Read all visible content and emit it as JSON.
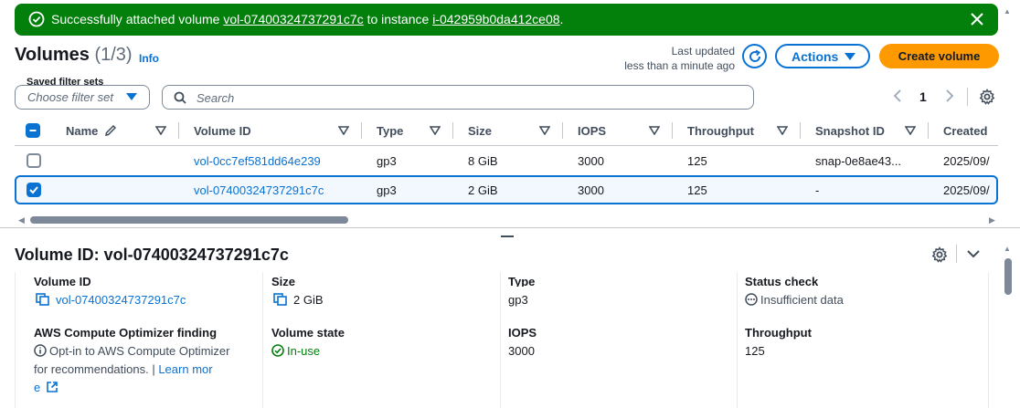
{
  "banner": {
    "prefix": "Successfully attached volume ",
    "volume": "vol-07400324737291c7c",
    "middle": " to instance ",
    "instance": "i-042959b0da412ce08",
    "suffix": "."
  },
  "header": {
    "title": "Volumes",
    "count": "(1/3)",
    "info": "Info",
    "last_updated_label": "Last updated",
    "last_updated_value": "less than a minute ago",
    "actions_label": "Actions",
    "create_label": "Create volume"
  },
  "filters": {
    "saved_label": "Saved filter sets",
    "saved_placeholder": "Choose filter set",
    "search_placeholder": "Search",
    "page": "1"
  },
  "table": {
    "columns": [
      "Name",
      "Volume ID",
      "Type",
      "Size",
      "IOPS",
      "Throughput",
      "Snapshot ID",
      "Created"
    ],
    "rows": [
      {
        "name": "",
        "volume_id": "vol-0cc7ef581dd64e239",
        "type": "gp3",
        "size": "8 GiB",
        "iops": "3000",
        "throughput": "125",
        "snapshot": "snap-0e8ae43...",
        "created": "2025/09/",
        "selected": false
      },
      {
        "name": "",
        "volume_id": "vol-07400324737291c7c",
        "type": "gp3",
        "size": "2 GiB",
        "iops": "3000",
        "throughput": "125",
        "snapshot": "-",
        "created": "2025/09/",
        "selected": true
      }
    ]
  },
  "details": {
    "title": "Volume ID: vol-07400324737291c7c",
    "volume_id_label": "Volume ID",
    "volume_id_value": "vol-07400324737291c7c",
    "size_label": "Size",
    "size_value": "2 GiB",
    "type_label": "Type",
    "type_value": "gp3",
    "status_label": "Status check",
    "status_value": "Insufficient data",
    "optimizer_label": "AWS Compute Optimizer finding",
    "optimizer_line1": "Opt-in to AWS Compute Optimizer",
    "optimizer_line2": "for recommendations. | ",
    "optimizer_link1": "Learn mor",
    "optimizer_link2": "e",
    "state_label": "Volume state",
    "state_value": "In-use",
    "iops_label": "IOPS",
    "iops_value": "3000",
    "throughput_label": "Throughput",
    "throughput_value": "125"
  },
  "colors": {
    "success": "#037f0c",
    "link": "#0972d3",
    "primary_button": "#ff9900"
  }
}
